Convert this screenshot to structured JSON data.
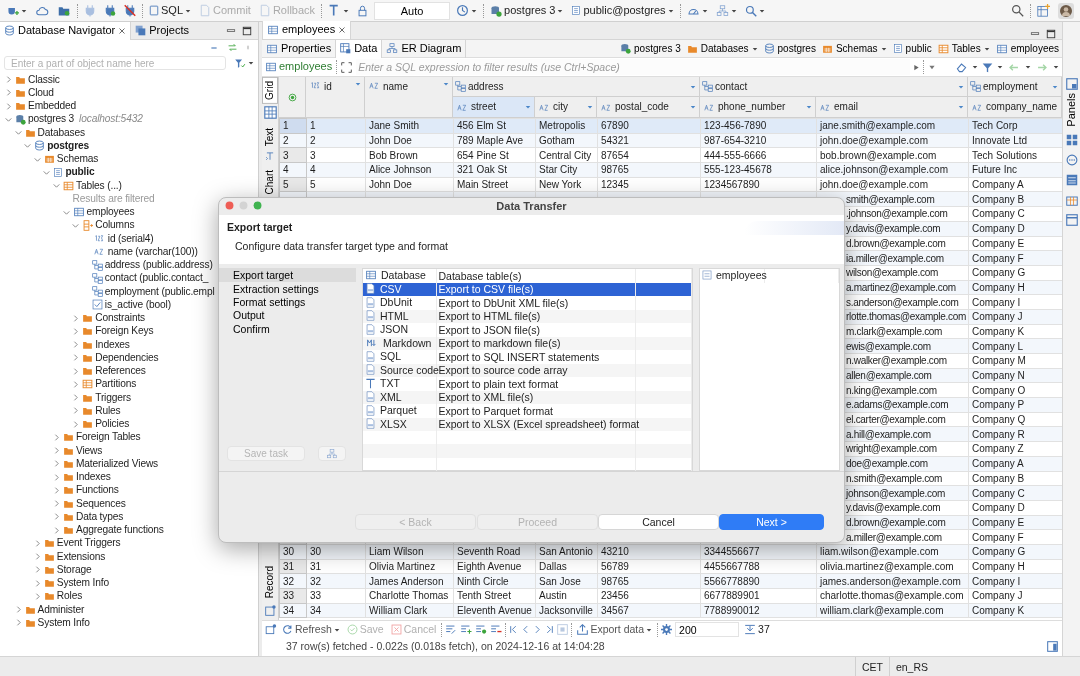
{
  "toolbar": {
    "buttons": [
      {
        "label": "SQL",
        "disabled": false
      },
      {
        "label": "Commit",
        "disabled": true
      },
      {
        "label": "Rollback",
        "disabled": true
      }
    ],
    "mode": "Auto",
    "connection": "postgres 3",
    "schema": "public@postgres"
  },
  "navigator": {
    "tabs": [
      {
        "label": "Database Navigator",
        "selected": true
      },
      {
        "label": "Projects",
        "selected": false
      }
    ],
    "search": {
      "placeholder": "Enter a part of object name here"
    },
    "tree": [
      {
        "label": "Classic",
        "kind": "folder",
        "expanded": false
      },
      {
        "label": "Cloud",
        "kind": "folder",
        "expanded": false
      },
      {
        "label": "Embedded",
        "kind": "folder",
        "expanded": false
      },
      {
        "label": "postgres 3",
        "note": "localhost:5432",
        "kind": "connection",
        "expanded": true,
        "children": [
          {
            "label": "Databases",
            "kind": "folder",
            "expanded": true,
            "children": [
              {
                "label": "postgres",
                "kind": "database",
                "bold": true,
                "expanded": true,
                "children": [
                  {
                    "label": "Schemas",
                    "kind": "schemas",
                    "expanded": true,
                    "children": [
                      {
                        "label": "public",
                        "kind": "schema",
                        "bold": true,
                        "expanded": true,
                        "children": [
                          {
                            "label": "Tables (...)",
                            "kind": "tables",
                            "expanded": true,
                            "children": [
                              {
                                "label": "Results are filtered",
                                "kind": "info"
                              },
                              {
                                "label": "employees",
                                "kind": "table",
                                "expanded": true,
                                "children": [
                                  {
                                    "label": "Columns",
                                    "kind": "columns",
                                    "expanded": true,
                                    "children": [
                                      {
                                        "label": "id (serial4)",
                                        "kind": "number"
                                      },
                                      {
                                        "label": "name (varchar(100))",
                                        "kind": "text"
                                      },
                                      {
                                        "label": "address (public.address)",
                                        "kind": "struct"
                                      },
                                      {
                                        "label": "contact (public.contact_",
                                        "kind": "struct"
                                      },
                                      {
                                        "label": "employment (public.empl",
                                        "kind": "struct"
                                      },
                                      {
                                        "label": "is_active (bool)",
                                        "kind": "bool"
                                      }
                                    ]
                                  },
                                  {
                                    "label": "Constraints",
                                    "kind": "folder",
                                    "expanded": false
                                  },
                                  {
                                    "label": "Foreign Keys",
                                    "kind": "folder",
                                    "expanded": false
                                  },
                                  {
                                    "label": "Indexes",
                                    "kind": "folder",
                                    "expanded": false
                                  },
                                  {
                                    "label": "Dependencies",
                                    "kind": "folder",
                                    "expanded": false
                                  },
                                  {
                                    "label": "References",
                                    "kind": "folder",
                                    "expanded": false
                                  },
                                  {
                                    "label": "Partitions",
                                    "kind": "tables",
                                    "expanded": false
                                  },
                                  {
                                    "label": "Triggers",
                                    "kind": "folder",
                                    "expanded": false
                                  },
                                  {
                                    "label": "Rules",
                                    "kind": "folder",
                                    "expanded": false
                                  },
                                  {
                                    "label": "Policies",
                                    "kind": "folder",
                                    "expanded": false
                                  }
                                ]
                              }
                            ]
                          },
                          {
                            "label": "Foreign Tables",
                            "kind": "folder",
                            "expanded": false
                          },
                          {
                            "label": "Views",
                            "kind": "folder",
                            "expanded": false
                          },
                          {
                            "label": "Materialized Views",
                            "kind": "folder",
                            "expanded": false
                          },
                          {
                            "label": "Indexes",
                            "kind": "folder",
                            "expanded": false
                          },
                          {
                            "label": "Functions",
                            "kind": "folder",
                            "expanded": false
                          },
                          {
                            "label": "Sequences",
                            "kind": "folder",
                            "expanded": false
                          },
                          {
                            "label": "Data types",
                            "kind": "folder",
                            "expanded": false
                          },
                          {
                            "label": "Aggregate functions",
                            "kind": "folder",
                            "expanded": false
                          }
                        ]
                      }
                    ]
                  },
                  {
                    "label": "Event Triggers",
                    "kind": "folder",
                    "expanded": false
                  },
                  {
                    "label": "Extensions",
                    "kind": "folder",
                    "expanded": false
                  },
                  {
                    "label": "Storage",
                    "kind": "folder",
                    "expanded": false
                  },
                  {
                    "label": "System Info",
                    "kind": "folder",
                    "expanded": false
                  },
                  {
                    "label": "Roles",
                    "kind": "folder",
                    "expanded": false
                  }
                ]
              }
            ]
          },
          {
            "label": "Administer",
            "kind": "folder",
            "expanded": false
          },
          {
            "label": "System Info",
            "kind": "folder",
            "expanded": false
          }
        ]
      }
    ]
  },
  "editor": {
    "tab": "employees",
    "subtabs": [
      {
        "label": "Properties",
        "selected": false
      },
      {
        "label": "Data",
        "selected": true
      },
      {
        "label": "ER Diagram",
        "selected": false
      }
    ],
    "breadcrumb": [
      {
        "label": "postgres 3",
        "dropdown": false
      },
      {
        "label": "Databases",
        "dropdown": true
      },
      {
        "label": "postgres",
        "dropdown": false
      },
      {
        "label": "Schemas",
        "dropdown": true
      },
      {
        "label": "public",
        "dropdown": false
      },
      {
        "label": "Tables",
        "dropdown": true
      },
      {
        "label": "employees",
        "dropdown": false
      }
    ],
    "filter": {
      "table": "employees",
      "placeholder": "Enter a SQL expression to filter results (use Ctrl+Space)"
    },
    "views": [
      {
        "label": "Grid",
        "selected": true
      },
      {
        "label": "Text",
        "selected": false
      },
      {
        "label": "Chart",
        "selected": false
      },
      {
        "label": "Record",
        "selected": false
      }
    ],
    "grid": {
      "column_groups": [
        {
          "label": "address",
          "kind": "struct"
        },
        {
          "label": "contact",
          "kind": "struct"
        },
        {
          "label": "employment",
          "kind": "struct"
        }
      ],
      "columns": [
        {
          "label": "id",
          "kind": "number",
          "grouped": false,
          "selected": false
        },
        {
          "label": "name",
          "kind": "text",
          "grouped": false,
          "selected": false
        },
        {
          "label": "street",
          "kind": "text",
          "grouped": true,
          "group_start": true,
          "selected": true
        },
        {
          "label": "city",
          "kind": "text",
          "grouped": true,
          "group_start": false,
          "selected": false
        },
        {
          "label": "postal_code",
          "kind": "text",
          "grouped": true,
          "group_start": false,
          "selected": false
        },
        {
          "label": "phone_number",
          "kind": "text",
          "grouped": true,
          "group_start": true,
          "selected": false
        },
        {
          "label": "email",
          "kind": "text",
          "grouped": true,
          "group_start": false,
          "selected": false
        },
        {
          "label": "company_name",
          "kind": "text",
          "grouped": true,
          "group_start": true,
          "selected": false
        }
      ],
      "rows": [
        {
          "kind": "full",
          "number": "1",
          "selected": true,
          "cells": [
            "1",
            "Jane Smith",
            "456 Elm St",
            "Metropolis",
            "67890",
            "123-456-7890",
            "jane.smith@example.com",
            "Tech Corp"
          ]
        },
        {
          "kind": "full",
          "number": "2",
          "selected": false,
          "cells": [
            "2",
            "John Doe",
            "789 Maple Ave",
            "Gotham",
            "54321",
            "987-654-3210",
            "john.doe@example.com",
            "Innovate Ltd"
          ]
        },
        {
          "kind": "full",
          "number": "3",
          "selected": false,
          "cells": [
            "3",
            "Bob Brown",
            "654 Pine St",
            "Central City",
            "87654",
            "444-555-6666",
            "bob.brown@example.com",
            "Tech Solutions"
          ]
        },
        {
          "kind": "full",
          "number": "4",
          "selected": false,
          "cells": [
            "4",
            "Alice Johnson",
            "321 Oak St",
            "Star City",
            "98765",
            "555-123-45678",
            "alice.johnson@example.com",
            "Future Inc"
          ]
        },
        {
          "kind": "full",
          "number": "5",
          "selected": false,
          "cells": [
            "5",
            "John Doe",
            "Main Street",
            "New York",
            "12345",
            "1234567890",
            "john.doe@example.com",
            "Company A"
          ]
        },
        {
          "kind": "covered",
          "cells": [
            "smith@example.com",
            "Company B"
          ]
        },
        {
          "kind": "covered",
          "cells": [
            ".johnson@example.com",
            "Company C"
          ]
        },
        {
          "kind": "covered",
          "cells": [
            "y.davis@example.com",
            "Company D"
          ]
        },
        {
          "kind": "covered",
          "cells": [
            "d.brown@example.com",
            "Company E"
          ]
        },
        {
          "kind": "covered",
          "cells": [
            "ia.miller@example.com",
            "Company F"
          ]
        },
        {
          "kind": "covered",
          "cells": [
            "wilson@example.com",
            "Company G"
          ]
        },
        {
          "kind": "covered",
          "cells": [
            "a.martinez@example.com",
            "Company H"
          ]
        },
        {
          "kind": "covered",
          "cells": [
            "s.anderson@example.com",
            "Company I"
          ]
        },
        {
          "kind": "covered",
          "cells": [
            "rlotte.thomas@example.com",
            "Company J"
          ]
        },
        {
          "kind": "covered",
          "cells": [
            "m.clark@example.com",
            "Company K"
          ]
        },
        {
          "kind": "covered",
          "cells": [
            "ewis@example.com",
            "Company L"
          ]
        },
        {
          "kind": "covered",
          "cells": [
            "n.walker@example.com",
            "Company M"
          ]
        },
        {
          "kind": "covered",
          "cells": [
            "allen@example.com",
            "Company N"
          ]
        },
        {
          "kind": "covered",
          "cells": [
            "n.king@example.com",
            "Company O"
          ]
        },
        {
          "kind": "covered",
          "cells": [
            "e.adams@example.com",
            "Company P"
          ]
        },
        {
          "kind": "covered",
          "cells": [
            "el.carter@example.com",
            "Company Q"
          ]
        },
        {
          "kind": "covered",
          "cells": [
            "a.hill@example.com",
            "Company R"
          ]
        },
        {
          "kind": "covered",
          "cells": [
            "wright@example.com",
            "Company Z"
          ]
        },
        {
          "kind": "covered",
          "cells": [
            "doe@example.com",
            "Company A"
          ]
        },
        {
          "kind": "covered",
          "cells": [
            "n.smith@example.com",
            "Company B"
          ]
        },
        {
          "kind": "covered",
          "cells": [
            "johnson@example.com",
            "Company C"
          ]
        },
        {
          "kind": "covered",
          "cells": [
            "y.davis@example.com",
            "Company D"
          ]
        },
        {
          "kind": "covered",
          "cells": [
            "d.brown@example.com",
            "Company E"
          ]
        },
        {
          "kind": "covered",
          "cells": [
            "a.miller@example.com",
            "Company F"
          ]
        },
        {
          "kind": "full",
          "number": "30",
          "selected": false,
          "cells": [
            "30",
            "Liam Wilson",
            "Seventh Road",
            "San Antonio",
            "43210",
            "3344556677",
            "liam.wilson@example.com",
            "Company G"
          ]
        },
        {
          "kind": "full",
          "number": "31",
          "selected": false,
          "cells": [
            "31",
            "Olivia Martinez",
            "Eighth Avenue",
            "Dallas",
            "56789",
            "4455667788",
            "olivia.martinez@example.com",
            "Company H"
          ]
        },
        {
          "kind": "full",
          "number": "32",
          "selected": false,
          "cells": [
            "32",
            "James Anderson",
            "Ninth Circle",
            "San Jose",
            "98765",
            "5566778890",
            "james.anderson@example.com",
            "Company I"
          ]
        },
        {
          "kind": "full",
          "number": "33",
          "selected": false,
          "cells": [
            "33",
            "Charlotte Thomas",
            "Tenth Street",
            "Austin",
            "23456",
            "6677889901",
            "charlotte.thomas@example.com",
            "Company J"
          ]
        },
        {
          "kind": "full",
          "number": "34",
          "selected": false,
          "cells": [
            "34",
            "William Clark",
            "Eleventh Avenue",
            "Jacksonville",
            "34567",
            "7788990012",
            "william.clark@example.com",
            "Company K"
          ]
        }
      ]
    },
    "results_toolbar": {
      "refresh": "Refresh",
      "save": {
        "label": "Save",
        "disabled": true
      },
      "cancel": {
        "label": "Cancel",
        "disabled": true
      },
      "export": "Export data",
      "fetch_size": "200",
      "row_count": "37"
    },
    "status": "37 row(s) fetched - 0.022s (0.018s fetch), on 2024-12-16 at 14:04:28"
  },
  "right_panel": {
    "label": "Panels"
  },
  "status_bar": {
    "timezone": "CET",
    "locale": "en_RS"
  },
  "dialog": {
    "title": "Data Transfer",
    "heading": "Export target",
    "subtitle": "Configure data transfer target type and format",
    "steps": [
      {
        "label": "Export target",
        "selected": true
      },
      {
        "label": "Extraction settings",
        "selected": false
      },
      {
        "label": "Format settings",
        "selected": false
      },
      {
        "label": "Output",
        "selected": false
      },
      {
        "label": "Confirm",
        "selected": false
      }
    ],
    "save_task": {
      "label": "Save task",
      "disabled": true
    },
    "formats": [
      {
        "name": "Database",
        "description": "Database table(s)",
        "kind": "database",
        "selected": false
      },
      {
        "name": "CSV",
        "description": "Export to CSV file(s)",
        "kind": "file",
        "selected": true
      },
      {
        "name": "DbUnit",
        "description": "Export to DbUnit XML file(s)",
        "kind": "file",
        "selected": false
      },
      {
        "name": "HTML",
        "description": "Export to HTML file(s)",
        "kind": "file",
        "selected": false
      },
      {
        "name": "JSON",
        "description": "Export to JSON file(s)",
        "kind": "file",
        "selected": false
      },
      {
        "name": "Markdown",
        "description": "Export to markdown file(s)",
        "kind": "markdown",
        "selected": false
      },
      {
        "name": "SQL",
        "description": "Export to SQL INSERT statements",
        "kind": "file",
        "selected": false
      },
      {
        "name": "Source code",
        "description": "Export to source code array",
        "kind": "file",
        "selected": false
      },
      {
        "name": "TXT",
        "description": "Export to plain text format",
        "kind": "text",
        "selected": false
      },
      {
        "name": "XML",
        "description": "Export to XML file(s)",
        "kind": "file",
        "selected": false
      },
      {
        "name": "Parquet",
        "description": "Export to Parquet format",
        "kind": "file",
        "selected": false
      },
      {
        "name": "XLSX",
        "description": "Export to XLSX (Excel spreadsheet) format",
        "kind": "file",
        "selected": false
      }
    ],
    "sources": [
      "employees"
    ],
    "buttons": [
      {
        "label": "< Back",
        "kind": "plain",
        "disabled": true
      },
      {
        "label": "Proceed",
        "kind": "plain",
        "disabled": true
      },
      {
        "label": "Cancel",
        "kind": "plain",
        "disabled": false
      },
      {
        "label": "Next >",
        "kind": "primary",
        "disabled": false
      }
    ]
  }
}
